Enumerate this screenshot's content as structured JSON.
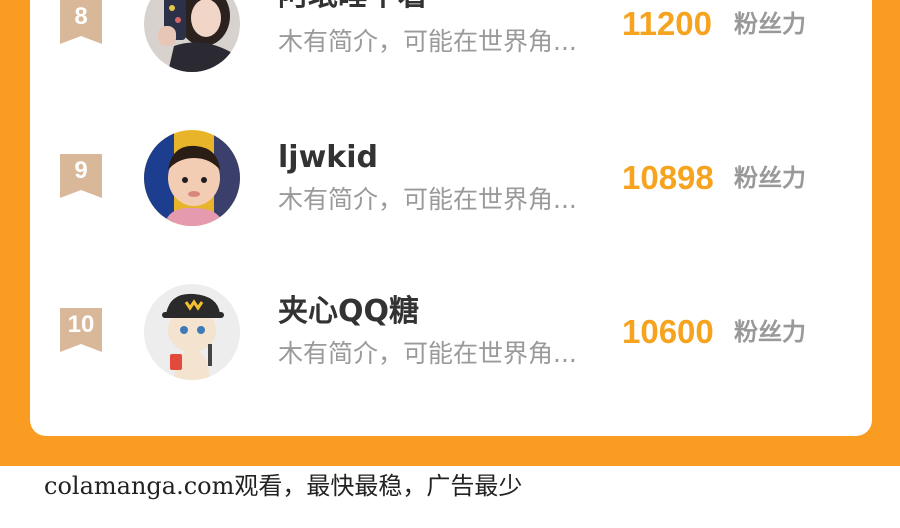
{
  "ranking": {
    "entries": [
      {
        "rank": "8",
        "name": "阿珉睡不着",
        "bio": "木有简介，可能在世界角...",
        "score": "11200",
        "unit": "粉丝力",
        "avatar_icon": "girl-with-phone-avatar"
      },
      {
        "rank": "9",
        "name": "ljwkid",
        "bio": "木有简介，可能在世界角...",
        "score": "10898",
        "unit": "粉丝力",
        "avatar_icon": "child-avatar"
      },
      {
        "rank": "10",
        "name": "夹心QQ糖",
        "bio": "木有简介，可能在世界角...",
        "score": "10600",
        "unit": "粉丝力",
        "avatar_icon": "cat-with-cap-avatar"
      }
    ]
  },
  "footer": {
    "text": "colamanga.com观看，最快最稳，广告最少"
  },
  "colors": {
    "accent_orange": "#fa9c22",
    "score_color": "#f6a31f",
    "badge_color": "#d9b89a"
  }
}
